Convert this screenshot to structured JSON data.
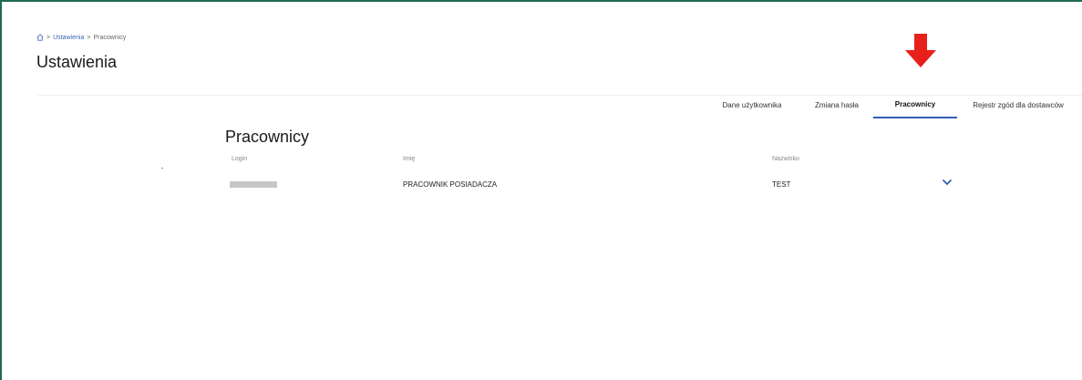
{
  "breadcrumb": {
    "home_icon": "home-icon",
    "items": [
      "Ustawienia",
      "Pracownicy"
    ],
    "separator": ">"
  },
  "page": {
    "title": "Ustawienia"
  },
  "tabs": [
    {
      "label": "Dane użytkownika",
      "active": false
    },
    {
      "label": "Zmiana hasła",
      "active": false
    },
    {
      "label": "Pracownicy",
      "active": true
    },
    {
      "label": "Rejestr zgód dla dostawców",
      "active": false
    }
  ],
  "annotation": {
    "icon": "red-down-arrow-icon",
    "color": "#e8201c"
  },
  "section": {
    "title": "Pracownicy",
    "columns": {
      "login": "Login",
      "first_name": "Imię",
      "last_name": "Nazwisko"
    },
    "rows": [
      {
        "login": "",
        "first_name": "PRACOWNIK POSIADACZA",
        "last_name": "TEST",
        "expand_icon": "chevron-down-icon"
      }
    ]
  },
  "colors": {
    "accent": "#2f5fb3",
    "frame": "#1f6b4f"
  }
}
